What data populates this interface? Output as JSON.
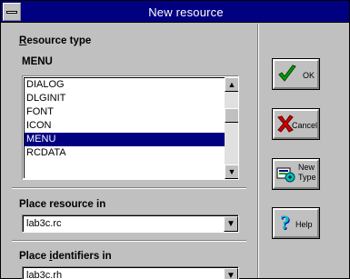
{
  "window": {
    "title": "New resource"
  },
  "resource_type": {
    "label_prefix": "",
    "label_accel": "R",
    "label_rest": "esource type",
    "current_value": "MENU",
    "list_items": [
      "DIALOG",
      "DLGINIT",
      "FONT",
      "ICON",
      "MENU",
      "RCDATA"
    ],
    "selected_item": "MENU"
  },
  "place_resource": {
    "label": "Place resource in",
    "value": "lab3c.rc"
  },
  "place_identifiers": {
    "label_prefix": "Place ",
    "label_accel": "i",
    "label_rest": "dentifiers in",
    "value": "lab3c.rh"
  },
  "buttons": {
    "ok": "OK",
    "cancel": "Cancel",
    "new_type_line1": "New",
    "new_type_line2": "Type",
    "help": "Help"
  },
  "icons": {
    "system_menu": "system-menu-icon",
    "ok": "green-checkmark-icon",
    "cancel": "red-x-icon",
    "new_type": "new-type-icon",
    "help": "question-mark-icon"
  }
}
